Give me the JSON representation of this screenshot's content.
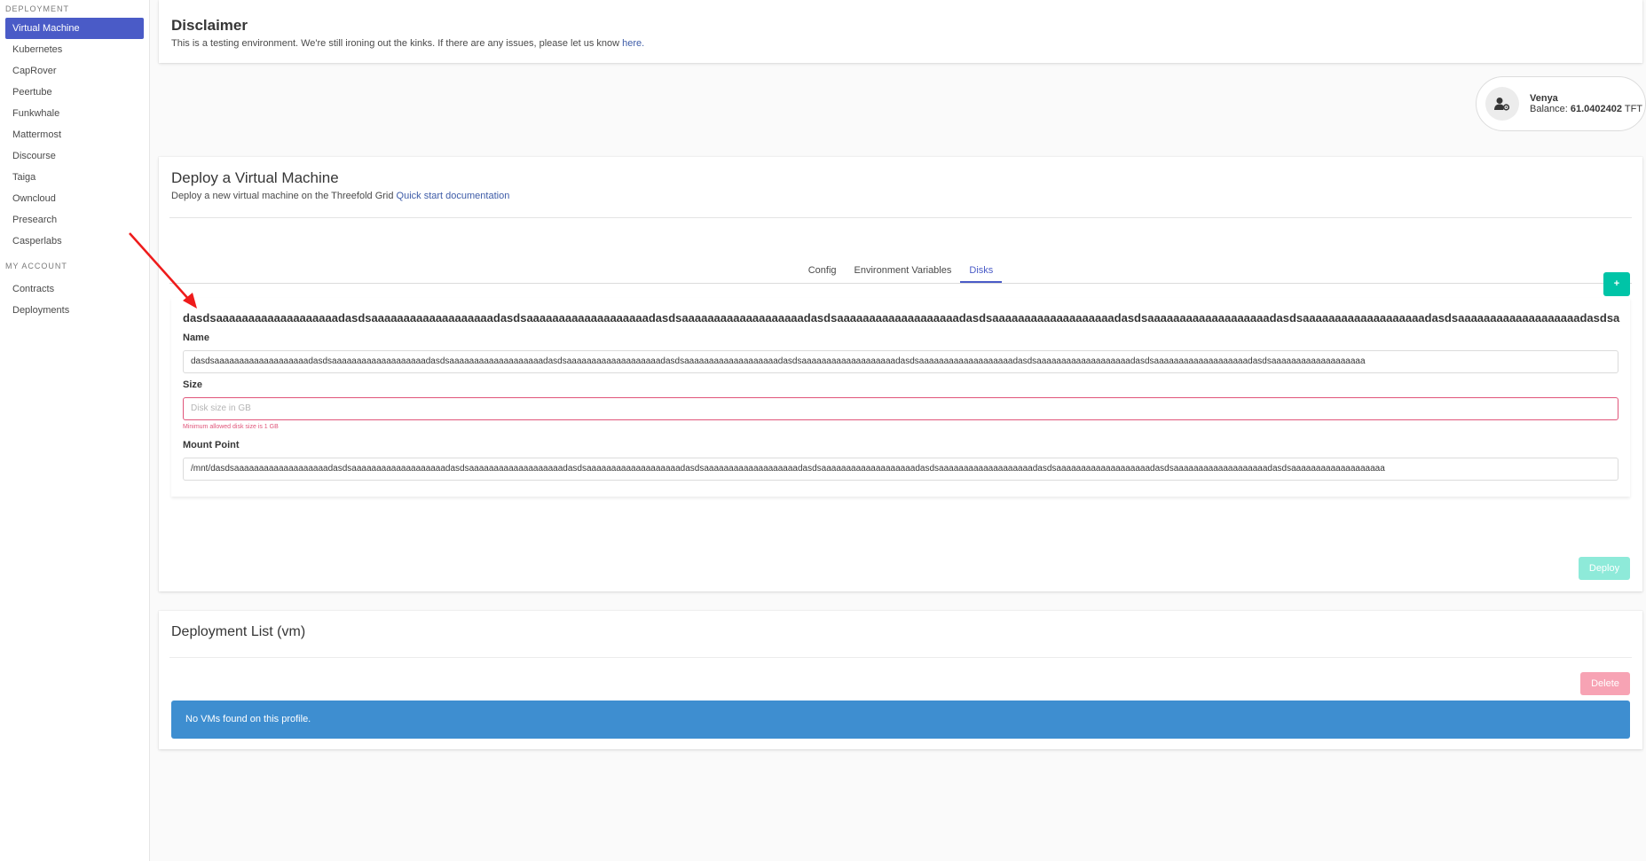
{
  "sidebar": {
    "deployment_label": "DEPLOYMENT",
    "items": [
      {
        "label": "Virtual Machine"
      },
      {
        "label": "Kubernetes"
      },
      {
        "label": "CapRover"
      },
      {
        "label": "Peertube"
      },
      {
        "label": "Funkwhale"
      },
      {
        "label": "Mattermost"
      },
      {
        "label": "Discourse"
      },
      {
        "label": "Taiga"
      },
      {
        "label": "Owncloud"
      },
      {
        "label": "Presearch"
      },
      {
        "label": "Casperlabs"
      }
    ],
    "account_label": "MY ACCOUNT",
    "account_items": [
      {
        "label": "Contracts"
      },
      {
        "label": "Deployments"
      }
    ]
  },
  "disclaimer": {
    "title": "Disclaimer",
    "text": "This is a testing environment. We're still ironing out the kinks. If there are any issues, please let us know ",
    "link": "here."
  },
  "profile": {
    "name": "Venya",
    "balance_label": "Balance: ",
    "balance_value": "61.0402402",
    "balance_unit": " TFT"
  },
  "deploy": {
    "title": "Deploy a Virtual Machine",
    "subtitle": "Deploy a new virtual machine on the Threefold Grid ",
    "doc_link": "Quick start documentation",
    "tabs": [
      "Config",
      "Environment Variables",
      "Disks"
    ],
    "add_label": "+",
    "disk_heading": "dasdsaaaaaaaaaaaaaaaaaaadasdsaaaaaaaaaaaaaaaaaaadasdsaaaaaaaaaaaaaaaaaaadasdsaaaaaaaaaaaaaaaaaaadasdsaaaaaaaaaaaaaaaaaaadasdsaaaaaaaaaaaaaaaaaaadasdsaaaaaaaaaaaaaaaaaaadasdsaaaaaaaaaaaaaaaaaaadasdsaaaaaaaaaaaaaaaaaaadasdsa",
    "name_label": "Name",
    "name_value": "dasdsaaaaaaaaaaaaaaaaaaadasdsaaaaaaaaaaaaaaaaaaadasdsaaaaaaaaaaaaaaaaaaadasdsaaaaaaaaaaaaaaaaaaadasdsaaaaaaaaaaaaaaaaaaadasdsaaaaaaaaaaaaaaaaaaadasdsaaaaaaaaaaaaaaaaaaadasdsaaaaaaaaaaaaaaaaaaadasdsaaaaaaaaaaaaaaaaaaadasdsaaaaaaaaaaaaaaaaaaa",
    "size_label": "Size",
    "size_placeholder": "Disk size in GB",
    "size_error": "Minimum allowed disk size is 1 GB",
    "mount_label": "Mount Point",
    "mount_value": "/mnt/dasdsaaaaaaaaaaaaaaaaaaadasdsaaaaaaaaaaaaaaaaaaadasdsaaaaaaaaaaaaaaaaaaadasdsaaaaaaaaaaaaaaaaaaadasdsaaaaaaaaaaaaaaaaaaadasdsaaaaaaaaaaaaaaaaaaadasdsaaaaaaaaaaaaaaaaaaadasdsaaaaaaaaaaaaaaaaaaadasdsaaaaaaaaaaaaaaaaaaadasdsaaaaaaaaaaaaaaaaaaa",
    "deploy_button": "Deploy"
  },
  "list": {
    "title": "Deployment List (vm)",
    "delete_button": "Delete",
    "empty_message": "No VMs found on this profile."
  },
  "colors": {
    "primary": "#4a5bc7",
    "success": "#00d1b2",
    "danger": "#f14668",
    "info": "#3e8ed0",
    "annotation": "#ee1b1b"
  }
}
